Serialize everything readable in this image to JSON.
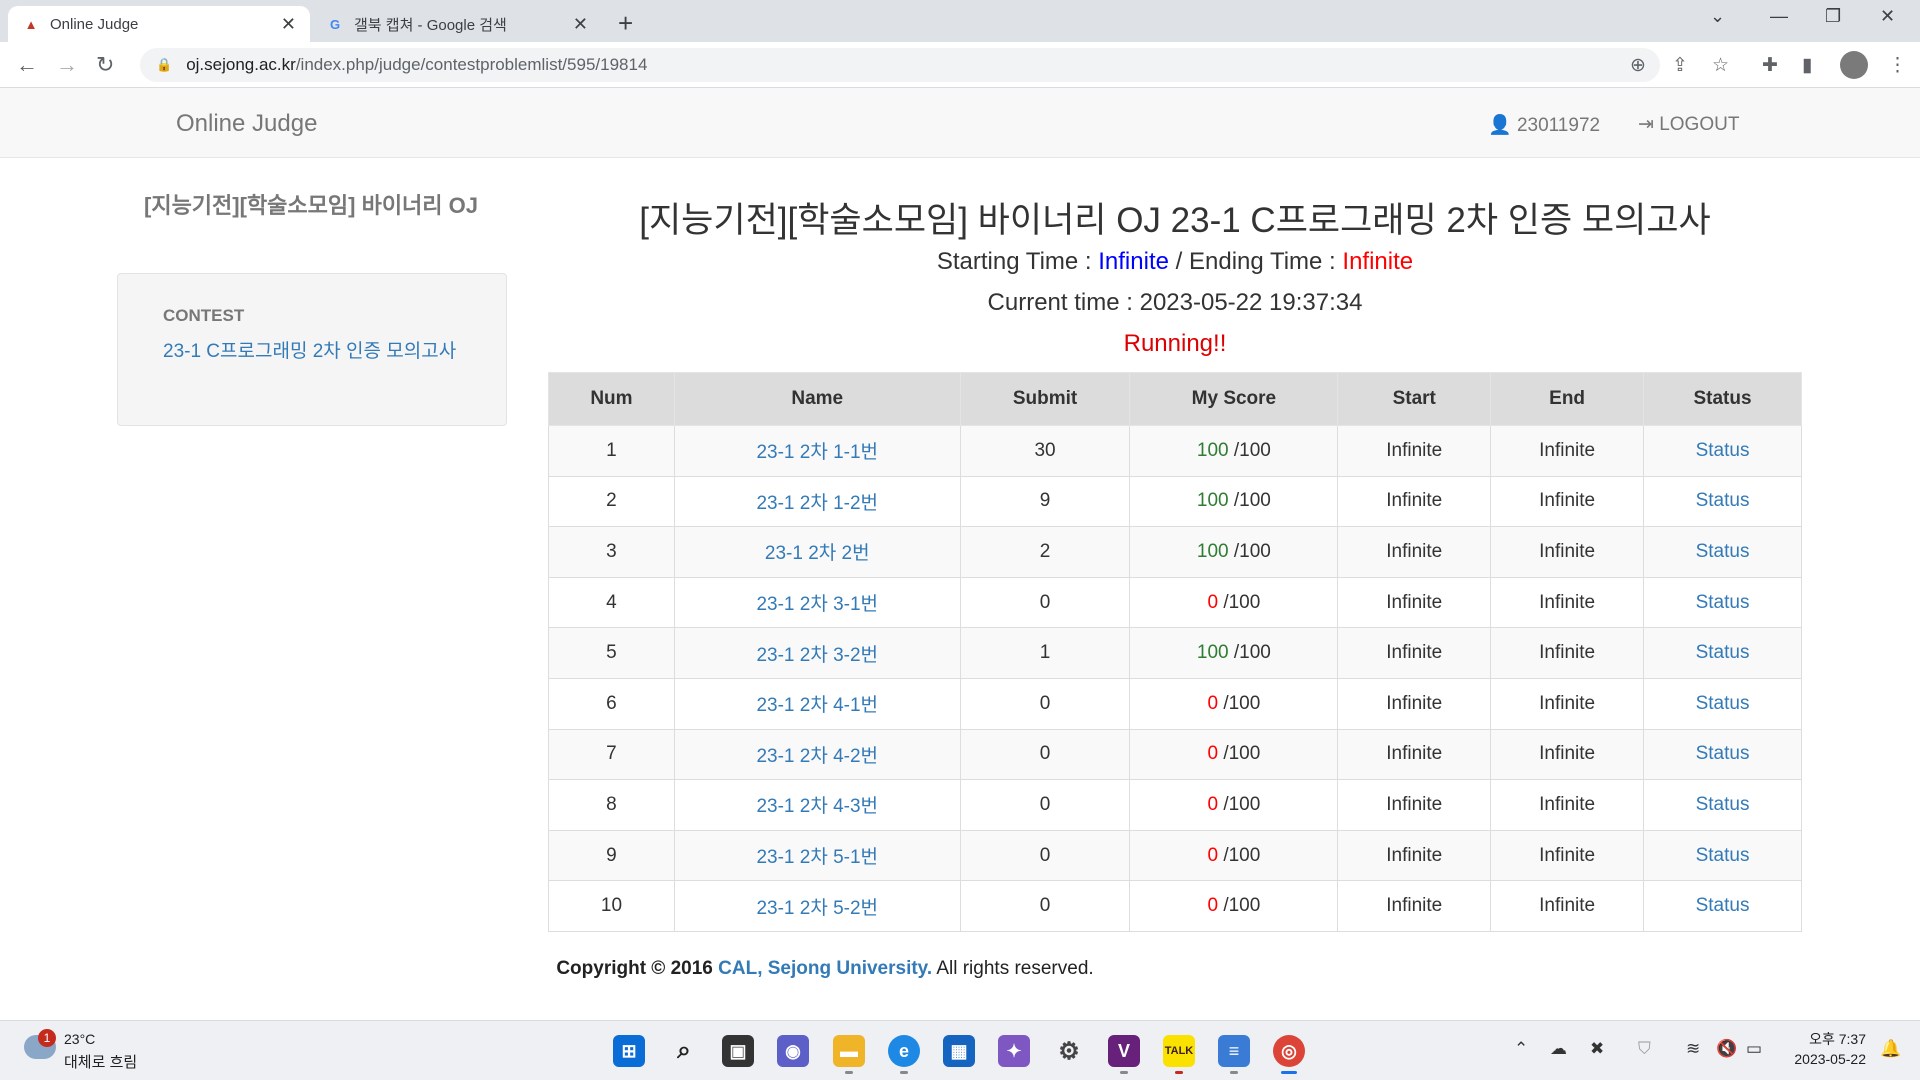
{
  "browser": {
    "tabs": [
      {
        "title": "Online Judge",
        "active": true
      },
      {
        "title": "갤북 캡쳐 - Google 검색",
        "active": false
      }
    ],
    "url_host": "oj.sejong.ac.kr",
    "url_path": "/index.php/judge/contestproblemlist/595/19814"
  },
  "navbar": {
    "brand": "Online Judge",
    "user": "23011972",
    "logout": "LOGOUT"
  },
  "sidebar": {
    "title": "[지능기전][학술소모임] 바이너리 OJ",
    "section_heading": "CONTEST",
    "contest_link": "23-1 C프로그래밍 2차 인증 모의고사"
  },
  "contest": {
    "title": "[지능기전][학술소모임] 바이너리 OJ 23-1 C프로그래밍 2차 인증 모의고사",
    "starting_label": "Starting Time : ",
    "starting_value": "Infinite",
    "separator": " / ",
    "ending_label": "Ending Time : ",
    "ending_value": "Infinite",
    "current_label": "Current time : ",
    "current_value": "2023-05-22 19:37:34",
    "status": "Running!!"
  },
  "table": {
    "headers": [
      "Num",
      "Name",
      "Submit",
      "My Score",
      "Start",
      "End",
      "Status"
    ],
    "rows": [
      {
        "num": "1",
        "name": "23-1 2차 1-1번",
        "submit": "30",
        "score": "100",
        "max": " /100",
        "start": "Infinite",
        "end": "Infinite",
        "status": "Status"
      },
      {
        "num": "2",
        "name": "23-1 2차 1-2번",
        "submit": "9",
        "score": "100",
        "max": " /100",
        "start": "Infinite",
        "end": "Infinite",
        "status": "Status"
      },
      {
        "num": "3",
        "name": "23-1 2차 2번",
        "submit": "2",
        "score": "100",
        "max": " /100",
        "start": "Infinite",
        "end": "Infinite",
        "status": "Status"
      },
      {
        "num": "4",
        "name": "23-1 2차 3-1번",
        "submit": "0",
        "score": "0",
        "max": " /100",
        "start": "Infinite",
        "end": "Infinite",
        "status": "Status"
      },
      {
        "num": "5",
        "name": "23-1 2차 3-2번",
        "submit": "1",
        "score": "100",
        "max": " /100",
        "start": "Infinite",
        "end": "Infinite",
        "status": "Status"
      },
      {
        "num": "6",
        "name": "23-1 2차 4-1번",
        "submit": "0",
        "score": "0",
        "max": " /100",
        "start": "Infinite",
        "end": "Infinite",
        "status": "Status"
      },
      {
        "num": "7",
        "name": "23-1 2차 4-2번",
        "submit": "0",
        "score": "0",
        "max": " /100",
        "start": "Infinite",
        "end": "Infinite",
        "status": "Status"
      },
      {
        "num": "8",
        "name": "23-1 2차 4-3번",
        "submit": "0",
        "score": "0",
        "max": " /100",
        "start": "Infinite",
        "end": "Infinite",
        "status": "Status"
      },
      {
        "num": "9",
        "name": "23-1 2차 5-1번",
        "submit": "0",
        "score": "0",
        "max": " /100",
        "start": "Infinite",
        "end": "Infinite",
        "status": "Status"
      },
      {
        "num": "10",
        "name": "23-1 2차 5-2번",
        "submit": "0",
        "score": "0",
        "max": " /100",
        "start": "Infinite",
        "end": "Infinite",
        "status": "Status"
      }
    ]
  },
  "footer": {
    "copyright": "Copyright © 2016 ",
    "cal": "CAL,",
    "space": " ",
    "univ": "Sejong University.",
    "rights": " All rights reserved."
  },
  "taskbar": {
    "weather_badge": "1",
    "temperature": "23°C",
    "weather": "대체로 흐림",
    "time": "오후 7:37",
    "date": "2023-05-22"
  },
  "colors": {
    "link": "#337ab7",
    "score_full": "#2e7d32",
    "score_zero": "#ff0000",
    "infinite_start": "#0000ff",
    "infinite_end": "#ff0000"
  }
}
